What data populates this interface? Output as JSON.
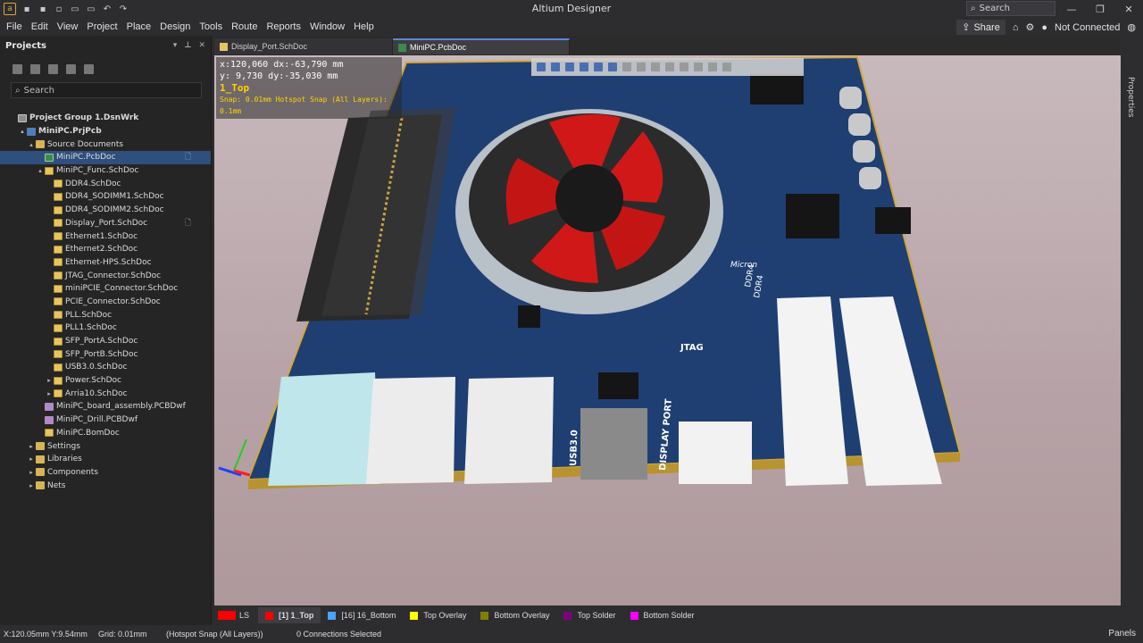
{
  "app": {
    "title": "Altium Designer",
    "search_label": "Search",
    "window_buttons": [
      "minimize-icon",
      "restore-icon",
      "close-icon"
    ]
  },
  "menu": {
    "items": [
      "File",
      "Edit",
      "View",
      "Project",
      "Place",
      "Design",
      "Tools",
      "Route",
      "Reports",
      "Window",
      "Help"
    ],
    "share_label": "Share",
    "connection_status": "Not Connected"
  },
  "projects_panel": {
    "title": "Projects",
    "search_placeholder": "Search",
    "tree": [
      {
        "label": "Project Group 1.DsnWrk",
        "level": 0,
        "icon": "grp",
        "arrow": "",
        "bold": true
      },
      {
        "label": "MiniPC.PrjPcb",
        "level": 1,
        "icon": "prj",
        "arrow": "▴",
        "bold": true
      },
      {
        "label": "Source Documents",
        "level": 2,
        "icon": "folder",
        "arrow": "▴"
      },
      {
        "label": "MiniPC.PcbDoc",
        "level": 3,
        "icon": "pcb",
        "arrow": "",
        "selected": true,
        "mark": "🗋"
      },
      {
        "label": "MiniPC_Func.SchDoc",
        "level": 3,
        "icon": "sch",
        "arrow": "▴"
      },
      {
        "label": "DDR4.SchDoc",
        "level": 4,
        "icon": "sch",
        "arrow": ""
      },
      {
        "label": "DDR4_SODIMM1.SchDoc",
        "level": 4,
        "icon": "sch",
        "arrow": ""
      },
      {
        "label": "DDR4_SODIMM2.SchDoc",
        "level": 4,
        "icon": "sch",
        "arrow": ""
      },
      {
        "label": "Display_Port.SchDoc",
        "level": 4,
        "icon": "sch",
        "arrow": "",
        "mark": "🗋"
      },
      {
        "label": "Ethernet1.SchDoc",
        "level": 4,
        "icon": "sch",
        "arrow": ""
      },
      {
        "label": "Ethernet2.SchDoc",
        "level": 4,
        "icon": "sch",
        "arrow": ""
      },
      {
        "label": "Ethernet-HPS.SchDoc",
        "level": 4,
        "icon": "sch",
        "arrow": ""
      },
      {
        "label": "JTAG_Connector.SchDoc",
        "level": 4,
        "icon": "sch",
        "arrow": ""
      },
      {
        "label": "miniPCIE_Connector.SchDoc",
        "level": 4,
        "icon": "sch",
        "arrow": ""
      },
      {
        "label": "PCIE_Connector.SchDoc",
        "level": 4,
        "icon": "sch",
        "arrow": ""
      },
      {
        "label": "PLL.SchDoc",
        "level": 4,
        "icon": "sch",
        "arrow": ""
      },
      {
        "label": "PLL1.SchDoc",
        "level": 4,
        "icon": "sch",
        "arrow": ""
      },
      {
        "label": "SFP_PortA.SchDoc",
        "level": 4,
        "icon": "sch",
        "arrow": ""
      },
      {
        "label": "SFP_PortB.SchDoc",
        "level": 4,
        "icon": "sch",
        "arrow": ""
      },
      {
        "label": "USB3.0.SchDoc",
        "level": 4,
        "icon": "sch",
        "arrow": ""
      },
      {
        "label": "Power.SchDoc",
        "level": 4,
        "icon": "sch",
        "arrow": "▸"
      },
      {
        "label": "Arria10.SchDoc",
        "level": 4,
        "icon": "sch",
        "arrow": "▸"
      },
      {
        "label": "MiniPC_board_assembly.PCBDwf",
        "level": 3,
        "icon": "out",
        "arrow": ""
      },
      {
        "label": "MiniPC_Drill.PCBDwf",
        "level": 3,
        "icon": "out",
        "arrow": ""
      },
      {
        "label": "MiniPC.BomDoc",
        "level": 3,
        "icon": "sch",
        "arrow": ""
      },
      {
        "label": "Settings",
        "level": 2,
        "icon": "folder",
        "arrow": "▸"
      },
      {
        "label": "Libraries",
        "level": 2,
        "icon": "folder",
        "arrow": "▸"
      },
      {
        "label": "Components",
        "level": 2,
        "icon": "folder",
        "arrow": "▸"
      },
      {
        "label": "Nets",
        "level": 2,
        "icon": "folder",
        "arrow": "▸"
      }
    ]
  },
  "tabs": [
    {
      "label": "Display_Port.SchDoc",
      "active": false
    },
    {
      "label": "MiniPC.PcbDoc",
      "active": true
    }
  ],
  "right_panel": {
    "label": "Properties"
  },
  "canvas": {
    "coord_line1": "x:120,060  dx:-63,790 mm",
    "coord_line2": "y:  9,730   dy:-35,030 mm",
    "layer_name": "1_Top",
    "snap_text": "Snap: 0.01mm Hotspot Snap (All Layers): 0.1mm",
    "board_labels": {
      "ddr4_a": "DDR4",
      "ddr4_b": "DDR4",
      "micron": "Micron",
      "jtag": "JTAG",
      "usb": "USB3.0",
      "display_port": "DISPLAY PORT"
    }
  },
  "layer_tabs": {
    "ls_label": "LS",
    "layers": [
      {
        "label": "[1] 1_Top",
        "color": "#ff0000",
        "active": true
      },
      {
        "label": "[16] 16_Bottom",
        "color": "#4aa3ff",
        "active": false
      },
      {
        "label": "Top Overlay",
        "color": "#ffff00",
        "active": false
      },
      {
        "label": "Bottom Overlay",
        "color": "#808000",
        "active": false
      },
      {
        "label": "Top Solder",
        "color": "#800080",
        "active": false
      },
      {
        "label": "Bottom Solder",
        "color": "#ff00ff",
        "active": false
      }
    ]
  },
  "status": {
    "coordinates": "X:120.05mm Y:9.54mm",
    "grid": "Grid: 0.01mm",
    "snap": "(Hotspot Snap (All Layers))",
    "connections": "0 Connections Selected",
    "panels_label": "Panels"
  }
}
